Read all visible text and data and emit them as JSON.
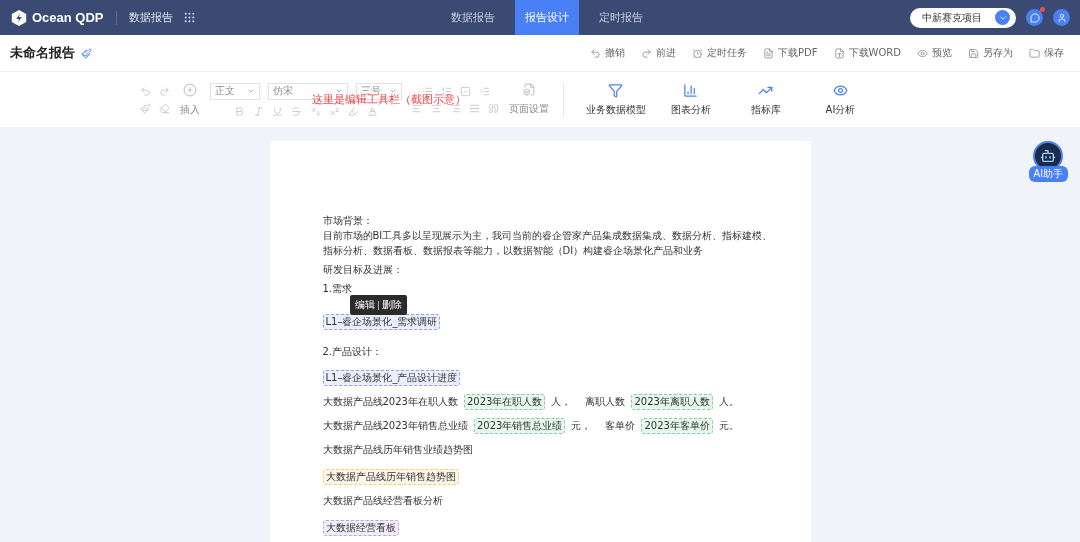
{
  "header": {
    "logo_text": "Ocean QDP",
    "module": "数据报告",
    "tabs": [
      {
        "label": "数据报告",
        "selected": false
      },
      {
        "label": "报告设计",
        "selected": true
      },
      {
        "label": "定时报告",
        "selected": false
      }
    ],
    "project": "中新赛克项目",
    "message_unread": true
  },
  "titlebar": {
    "title": "未命名报告",
    "actions": [
      {
        "kind": "undo",
        "label": "撤销"
      },
      {
        "kind": "redo",
        "label": "前进"
      },
      {
        "kind": "schedule",
        "label": "定时任务"
      },
      {
        "kind": "pdf",
        "label": "下载PDF"
      },
      {
        "kind": "word",
        "label": "下载WORD"
      },
      {
        "kind": "preview",
        "label": "预览"
      },
      {
        "kind": "saveas",
        "label": "另存为"
      },
      {
        "kind": "save",
        "label": "保存"
      }
    ]
  },
  "toolbar": {
    "insert_label": "插入",
    "style_select": "正文",
    "font_select": "仿宋",
    "size_select": "三号",
    "page_setup": "页面设置",
    "note": "这里是编辑工具栏（截图示意）",
    "tools": [
      {
        "kind": "model",
        "label": "业务数据模型"
      },
      {
        "kind": "chart",
        "label": "图表分析"
      },
      {
        "kind": "metric",
        "label": "指标库"
      },
      {
        "kind": "ai",
        "label": "AI分析"
      }
    ]
  },
  "assistant": {
    "label": "AI助手"
  },
  "document": {
    "tooltip": {
      "actions": [
        "编辑",
        "删除"
      ]
    },
    "blocks": [
      {
        "kind": "line",
        "text": "市场背景："
      },
      {
        "kind": "line",
        "text": "目前市场的BI工具多以呈现展示为主，我司当前的睿企管家产品集成数据集成、数据分析、指标建模、指标分析、数据看板、数据报表等能力，以数据智能（DI）构建睿企场景化产品和业务"
      },
      {
        "kind": "line",
        "text": "研发目标及进展："
      },
      {
        "kind": "line",
        "text": "1.需求",
        "tooltip": true
      },
      {
        "kind": "tag",
        "text": "L1–睿企场景化_需求调研",
        "color": "#8ea4f2"
      },
      {
        "kind": "line",
        "text": "2.产品设计："
      },
      {
        "kind": "tag",
        "text": "L1–睿企场景化_产品设计进度",
        "color": "#8ea4f2"
      },
      {
        "kind": "mixed",
        "parts": [
          {
            "kind": "text",
            "text": "大数据产品线2023年在职人数"
          },
          {
            "kind": "tag",
            "text": "2023年在职人数",
            "color": "#7fd3a0"
          },
          {
            "kind": "text",
            "text": "人，"
          },
          {
            "kind": "text",
            "text": "离职人数"
          },
          {
            "kind": "tag",
            "text": "2023年离职人数",
            "color": "#7fd3a0"
          },
          {
            "kind": "text",
            "text": "人。"
          }
        ]
      },
      {
        "kind": "mixed",
        "parts": [
          {
            "kind": "text",
            "text": "大数据产品线2023年销售总业绩"
          },
          {
            "kind": "tag",
            "text": "2023年销售总业绩",
            "color": "#7fd3a0"
          },
          {
            "kind": "text",
            "text": "元，"
          },
          {
            "kind": "text",
            "text": "客单价"
          },
          {
            "kind": "tag",
            "text": "2023年客单价",
            "color": "#7fd3a0"
          },
          {
            "kind": "text",
            "text": "元。"
          }
        ]
      },
      {
        "kind": "para",
        "text": "大数据产品线历年销售业绩趋势图"
      },
      {
        "kind": "tag",
        "text": "大数据产品线历年销售趋势图",
        "color": "#f3cf78"
      },
      {
        "kind": "para",
        "text": "大数据产品线经营看板分析"
      },
      {
        "kind": "tag",
        "text": "大数据经营看板",
        "color": "#b9a2f0"
      }
    ]
  }
}
